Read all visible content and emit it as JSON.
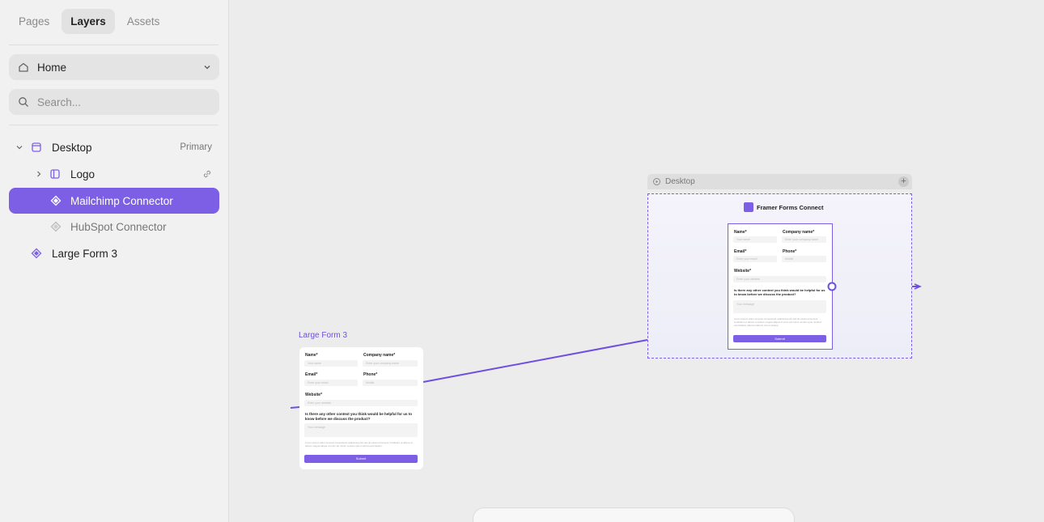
{
  "sidebar": {
    "tabs": [
      "Pages",
      "Layers",
      "Assets"
    ],
    "page_select": "Home",
    "search_placeholder": "Search...",
    "tree": {
      "desktop": {
        "label": "Desktop",
        "aside": "Primary"
      },
      "logo": {
        "label": "Logo"
      },
      "mailchimp": {
        "label": "Mailchimp Connector"
      },
      "hubspot": {
        "label": "HubSpot Connector"
      },
      "large_form": {
        "label": "Large Form 3"
      }
    }
  },
  "canvas": {
    "desktop_frame": {
      "header": "Desktop",
      "brand": "Framer Forms Connect",
      "form": {
        "name_label": "Name*",
        "name_placeholder": "Your name",
        "company_label": "Company name*",
        "company_placeholder": "Enter your company name",
        "email_label": "Email*",
        "email_placeholder": "Enter your email",
        "phone_label": "Phone*",
        "phone_placeholder": "Mobile",
        "website_label": "Website*",
        "website_placeholder": "Enter your website",
        "question": "Is there any other context you think would be helpful for us to know before we discuss the product?",
        "message_placeholder": "Your message",
        "fine_print": "Lorem ipsum dolor sit amet consectetur adipiscing elit sed do eiusmod tempor incididunt ut labore et dolore magna aliqua ut enim ad minim veniam quis nostrud exercitation ullamco laboris nisi ut aliquip.",
        "submit": "Submit"
      }
    },
    "large_form": {
      "title": "Large Form 3",
      "name_label": "Name*",
      "name_placeholder": "Your name",
      "company_label": "Company name*",
      "company_placeholder": "Enter your company name",
      "email_label": "Email*",
      "email_placeholder": "Enter your email",
      "phone_label": "Phone*",
      "phone_placeholder": "Mobile",
      "website_label": "Website*",
      "website_placeholder": "Enter your website",
      "question": "Is there any other context you think would be helpful for us to know before we discuss the product?",
      "message_placeholder": "Your message",
      "fine_print": "Lorem ipsum dolor sit amet consectetur adipiscing elit sed do eiusmod tempor incididunt ut labore et dolore magna aliqua ut enim ad minim veniam quis nostrud exercitation.",
      "submit": "Submit"
    }
  },
  "colors": {
    "accent": "#7d5fe6",
    "canvas": "#ececec",
    "sidebar": "#f1f1f1"
  }
}
